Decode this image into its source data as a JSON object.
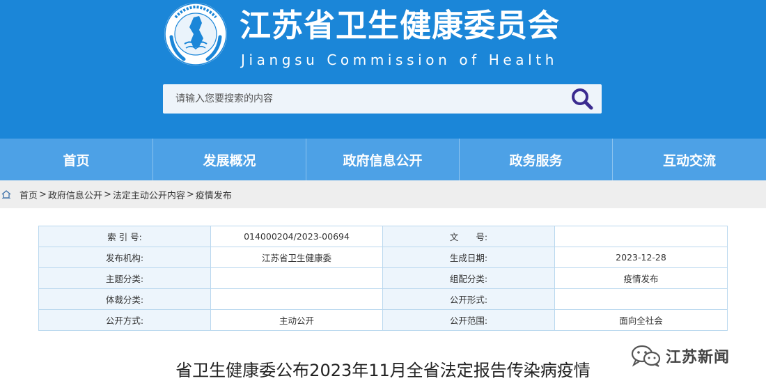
{
  "header": {
    "title": "江苏省卫生健康委员会",
    "subtitle": "Jiangsu Commission of Health",
    "emblem_text": "Jiangsu Commission of Health 江苏省卫生健康委员会",
    "bg_color": "#1b86d8"
  },
  "search": {
    "placeholder": "请输入您要搜索的内容",
    "icon": "search-icon"
  },
  "nav": {
    "items": [
      {
        "label": "首页"
      },
      {
        "label": "发展概况"
      },
      {
        "label": "政府信息公开"
      },
      {
        "label": "政务服务"
      },
      {
        "label": "互动交流"
      }
    ],
    "bg_color": "#4da1e6"
  },
  "breadcrumb": {
    "icon": "home-icon",
    "items": [
      "首页",
      "政府信息公开",
      "法定主动公开内容",
      "疫情发布"
    ],
    "separator": ">"
  },
  "meta": {
    "rows": [
      {
        "label1": "索 引 号:",
        "value1": "014000204/2023-00694",
        "label2": "文　　号:",
        "value2": ""
      },
      {
        "label1": "发布机构:",
        "value1": "江苏省卫生健康委",
        "label2": "生成日期:",
        "value2": "2023-12-28"
      },
      {
        "label1": "主题分类:",
        "value1": "",
        "label2": "组配分类:",
        "value2": "疫情发布"
      },
      {
        "label1": "体裁分类:",
        "value1": "",
        "label2": "公开形式:",
        "value2": ""
      },
      {
        "label1": "公开方式:",
        "value1": "主动公开",
        "label2": "公开范围:",
        "value2": "面向全社会"
      }
    ]
  },
  "watermark": {
    "text": "江苏新闻",
    "icon": "wechat-icon"
  },
  "article": {
    "title": "省卫生健康委公布2023年11月全省法定报告传染病疫情"
  }
}
